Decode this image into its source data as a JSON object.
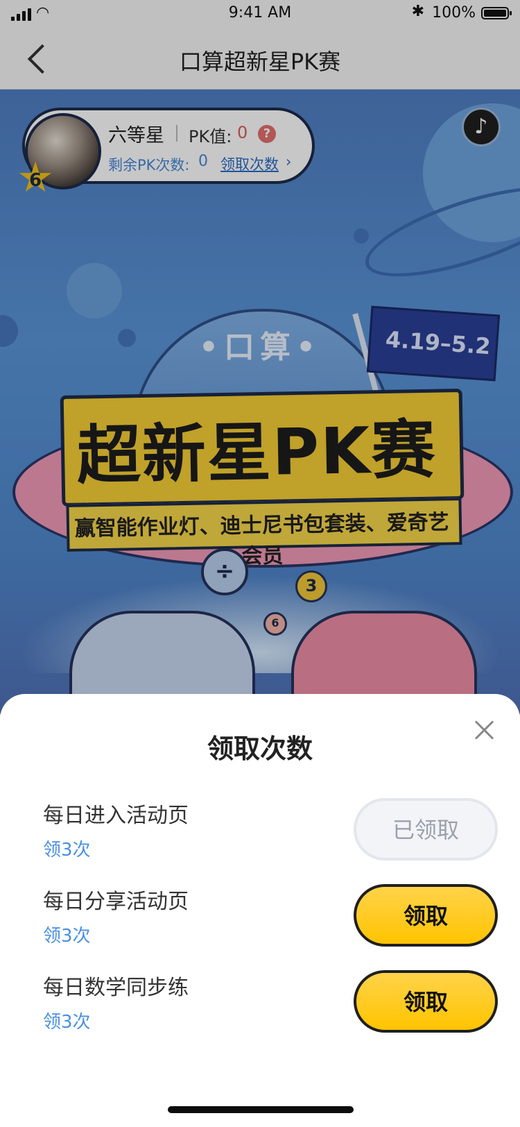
{
  "status_bar": {
    "time": "9:41 AM",
    "battery": "100%",
    "icons": [
      "signal-icon",
      "wifi-icon",
      "bluetooth-icon",
      "battery-icon"
    ]
  },
  "navbar": {
    "title": "口算超新星PK赛",
    "back_icon": "chevron-left-icon"
  },
  "player": {
    "rank_label": "六等星",
    "pk_label": "PK值:",
    "pk_value": "0",
    "help_icon": "question-icon",
    "remaining_label": "剩余PK次数:",
    "remaining_value": "0",
    "get_count_link": "领取次数",
    "chevron": "›",
    "star_level": "6"
  },
  "music_icon": "♪",
  "poster": {
    "dome_text": "•口算•",
    "date_range": "4.19–5.2",
    "main_title": "超新星PK赛",
    "subtitle": "赢智能作业灯、迪士尼书包套装、爱奇艺会员",
    "badge_divide": "÷",
    "badge_three": "3",
    "badge_six": "6"
  },
  "sheet": {
    "title": "领取次数",
    "close_icon": "close-icon",
    "tasks": [
      {
        "title": "每日进入活动页",
        "reward": "领3次",
        "button": "已领取",
        "claimed": true
      },
      {
        "title": "每日分享活动页",
        "reward": "领3次",
        "button": "领取",
        "claimed": false
      },
      {
        "title": "每日数学同步练",
        "reward": "领3次",
        "button": "领取",
        "claimed": false
      }
    ]
  },
  "colors": {
    "accent_yellow": "#ffc400",
    "link_blue": "#4a90e2",
    "pk_red": "#e05a5a",
    "hero_blue": "#5a95d8"
  }
}
